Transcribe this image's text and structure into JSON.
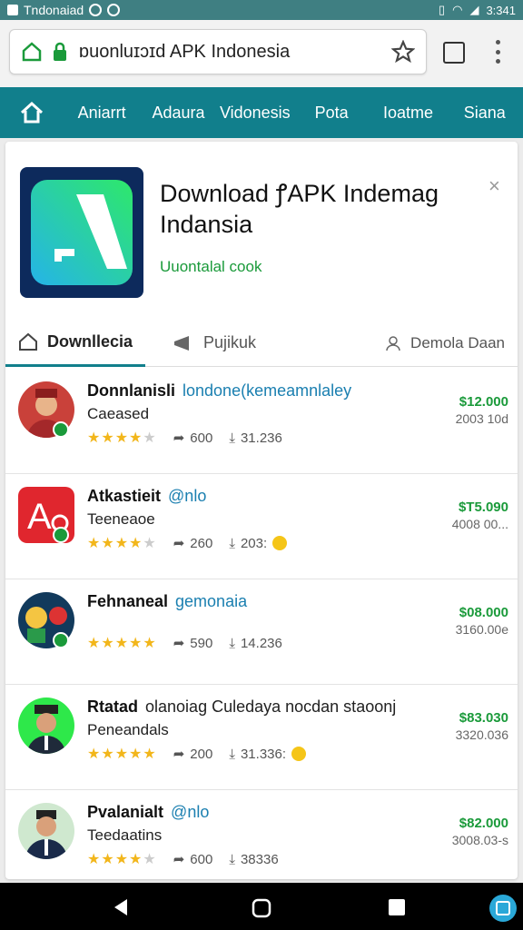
{
  "status": {
    "carrier": "Tndonaiad",
    "time": "3:341"
  },
  "browser": {
    "url": "ɒuonluɪɔɪd  APK Indonesia"
  },
  "nav": {
    "items": [
      "Aniarrt",
      "Adaura",
      "Vidonesis",
      "Pota",
      "Ioatme",
      "Siana"
    ]
  },
  "app": {
    "title": "Download ꝭAPK Indemag Indansia",
    "subtitle": "Uuontalal cook"
  },
  "tabs": [
    {
      "label": "Downllecia",
      "icon": "home-icon"
    },
    {
      "label": "Pujikuk",
      "icon": "megaphone-icon"
    },
    {
      "label": "Demola Daan",
      "icon": "user-icon"
    }
  ],
  "rows": [
    {
      "name": "Donnlanisli",
      "handle": "londone(kemeamnlaley",
      "desc": "Caeased",
      "stars": 4,
      "shares": "600",
      "count": "31.236",
      "price": "$12.000",
      "date": "2003 10d",
      "emoji": false
    },
    {
      "name": "Atkastieit",
      "handle": "@nlo",
      "desc": "Teeneaoe",
      "stars": 4,
      "shares": "260",
      "count": "203:",
      "price": "$T5.090",
      "date": "4008 00...",
      "emoji": true
    },
    {
      "name": "Fehnaneal",
      "handle": "gemonaia",
      "desc": "",
      "stars": 5,
      "shares": "590",
      "count": "14.236",
      "price": "$08.000",
      "date": "3160.00e",
      "emoji": false
    },
    {
      "name": "Rtatad",
      "handle": "olanoiag Culedaya nocdan staoonj",
      "desc": "Peneandals",
      "stars": 5,
      "shares": "200",
      "count": "31.336:",
      "price": "$83.030",
      "date": "3320.036",
      "emoji": true
    },
    {
      "name": "Pvalanialt",
      "handle": "@nlo",
      "desc": "Teedaatins",
      "stars": 4,
      "shares": "600",
      "count": "38336",
      "price": "$82.000",
      "date": "3008.03-s",
      "emoji": false
    }
  ],
  "colors": {
    "nav": "#117f8c",
    "accent_green": "#1a9a3a",
    "link": "#1a7fb0"
  }
}
